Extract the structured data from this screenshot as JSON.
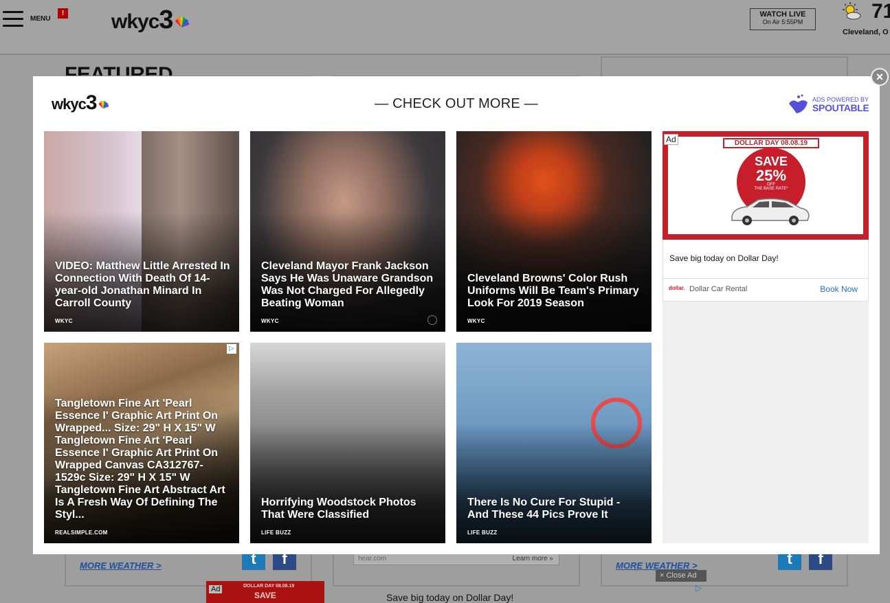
{
  "header": {
    "menu_label": "MENU",
    "alert_badge": "!",
    "logo_text": "wkyc",
    "logo_number": "3",
    "watch_live_title": "WATCH LIVE",
    "watch_live_sub": "On Air 5:55PM",
    "temperature": "71",
    "city": "Cleveland, O"
  },
  "page": {
    "featured_title": "FEATURED",
    "more_weather_left": "MORE WEATHER >",
    "more_weather_right": "MORE WEATHER >",
    "input_placeholder": "hear.com",
    "learn_more": "Learn more »",
    "bottom_text": "Save big today on Dollar Day!",
    "close_ad": "× Close Ad",
    "bottom_ad_tag": "Ad",
    "bottom_ad_header": "DOLLAR DAY 08.08.19",
    "bottom_ad_save": "SAVE"
  },
  "modal": {
    "close_symbol": "×",
    "logo_text": "wkyc",
    "logo_number": "3",
    "heading": "— CHECK OUT MORE —",
    "ads_powered_by": "ADS POWERED BY",
    "ads_brand": "SPOUTABLE",
    "cards": [
      {
        "title": "VIDEO: Matthew Little Arrested In Connection With Death Of 14-year-old Jonathan Minard In Carroll County",
        "source": "WKYC"
      },
      {
        "title": "Cleveland Mayor Frank Jackson Says He Was Unaware Grandson Was Not Charged For Allegedly Beating Woman",
        "source": "WKYC"
      },
      {
        "title": "Cleveland Browns' Color Rush Uniforms Will Be Team's Primary Look For 2019 Season",
        "source": "WKYC"
      },
      {
        "title": "Tangletown Fine Art 'Pearl Essence I' Graphic Art Print On Wrapped... Size: 29\" H X 15\" W Tangletown Fine Art 'Pearl Essence I' Graphic Art Print On Wrapped Canvas CA312767-1529c Size: 29\" H X 15\" W Tangletown Fine Art Abstract Art Is A Fresh Way Of Defining The Styl...",
        "source": "REALSIMPLE.COM"
      },
      {
        "title": "Horrifying Woodstock Photos That Were Classified",
        "source": "LIFE BUZZ"
      },
      {
        "title": "There Is No Cure For Stupid - And These 44 Pics Prove It",
        "source": "LIFE BUZZ"
      }
    ],
    "side_ad": {
      "ad_tag": "Ad",
      "date_banner": "DOLLAR DAY 08.08.19",
      "save_line": "SAVE",
      "percent": "25%",
      "off": "OFF",
      "base_rate": "THE BASE RATE*",
      "brand_logo": "dollar.",
      "message": "Save big today on Dollar Day!",
      "brand_mini": "dollar.",
      "brand_name": "Dollar Car Rental",
      "cta": "Book Now"
    }
  }
}
